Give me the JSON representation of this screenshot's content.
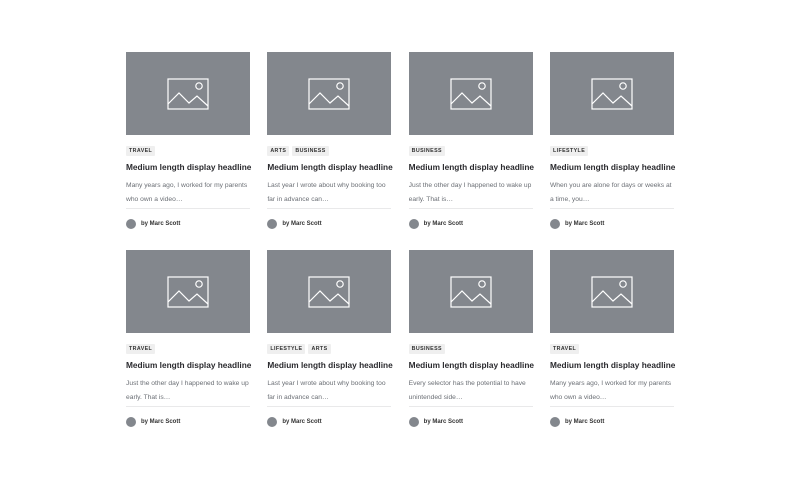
{
  "cards": [
    {
      "tags": [
        "TRAVEL"
      ],
      "headline": "Medium length display headline",
      "excerpt": "Many years ago, I worked for my parents who own a video…",
      "byline": "by Marc Scott"
    },
    {
      "tags": [
        "ARTS",
        "BUSINESS"
      ],
      "headline": "Medium length display headline",
      "excerpt": "Last year I wrote about why booking too far in advance can…",
      "byline": "by Marc Scott"
    },
    {
      "tags": [
        "BUSINESS"
      ],
      "headline": "Medium length display headline",
      "excerpt": "Just the other day I happened to wake up early. That is…",
      "byline": "by Marc Scott"
    },
    {
      "tags": [
        "LIFESTYLE"
      ],
      "headline": "Medium length display headline",
      "excerpt": "When you are alone for days or weeks at a time, you…",
      "byline": "by Marc Scott"
    },
    {
      "tags": [
        "TRAVEL"
      ],
      "headline": "Medium length display headline",
      "excerpt": "Just the other day I happened to wake up early. That is…",
      "byline": "by Marc Scott"
    },
    {
      "tags": [
        "LIFESTYLE",
        "ARTS"
      ],
      "headline": "Medium length display headline",
      "excerpt": "Last year I wrote about why booking too far in advance can…",
      "byline": "by Marc Scott"
    },
    {
      "tags": [
        "BUSINESS"
      ],
      "headline": "Medium length display headline",
      "excerpt": "Every selector has the potential to have unintended side…",
      "byline": "by Marc Scott"
    },
    {
      "tags": [
        "TRAVEL"
      ],
      "headline": "Medium length display headline",
      "excerpt": "Many years ago, I worked for my parents who own a video…",
      "byline": "by Marc Scott"
    }
  ],
  "colors": {
    "placeholder": "#83878d",
    "tag_bg": "#efefef",
    "headline": "#2a2a2e",
    "excerpt": "#6b6f75"
  },
  "icons": {
    "thumbnail": "image-placeholder-icon",
    "avatar": "avatar"
  }
}
